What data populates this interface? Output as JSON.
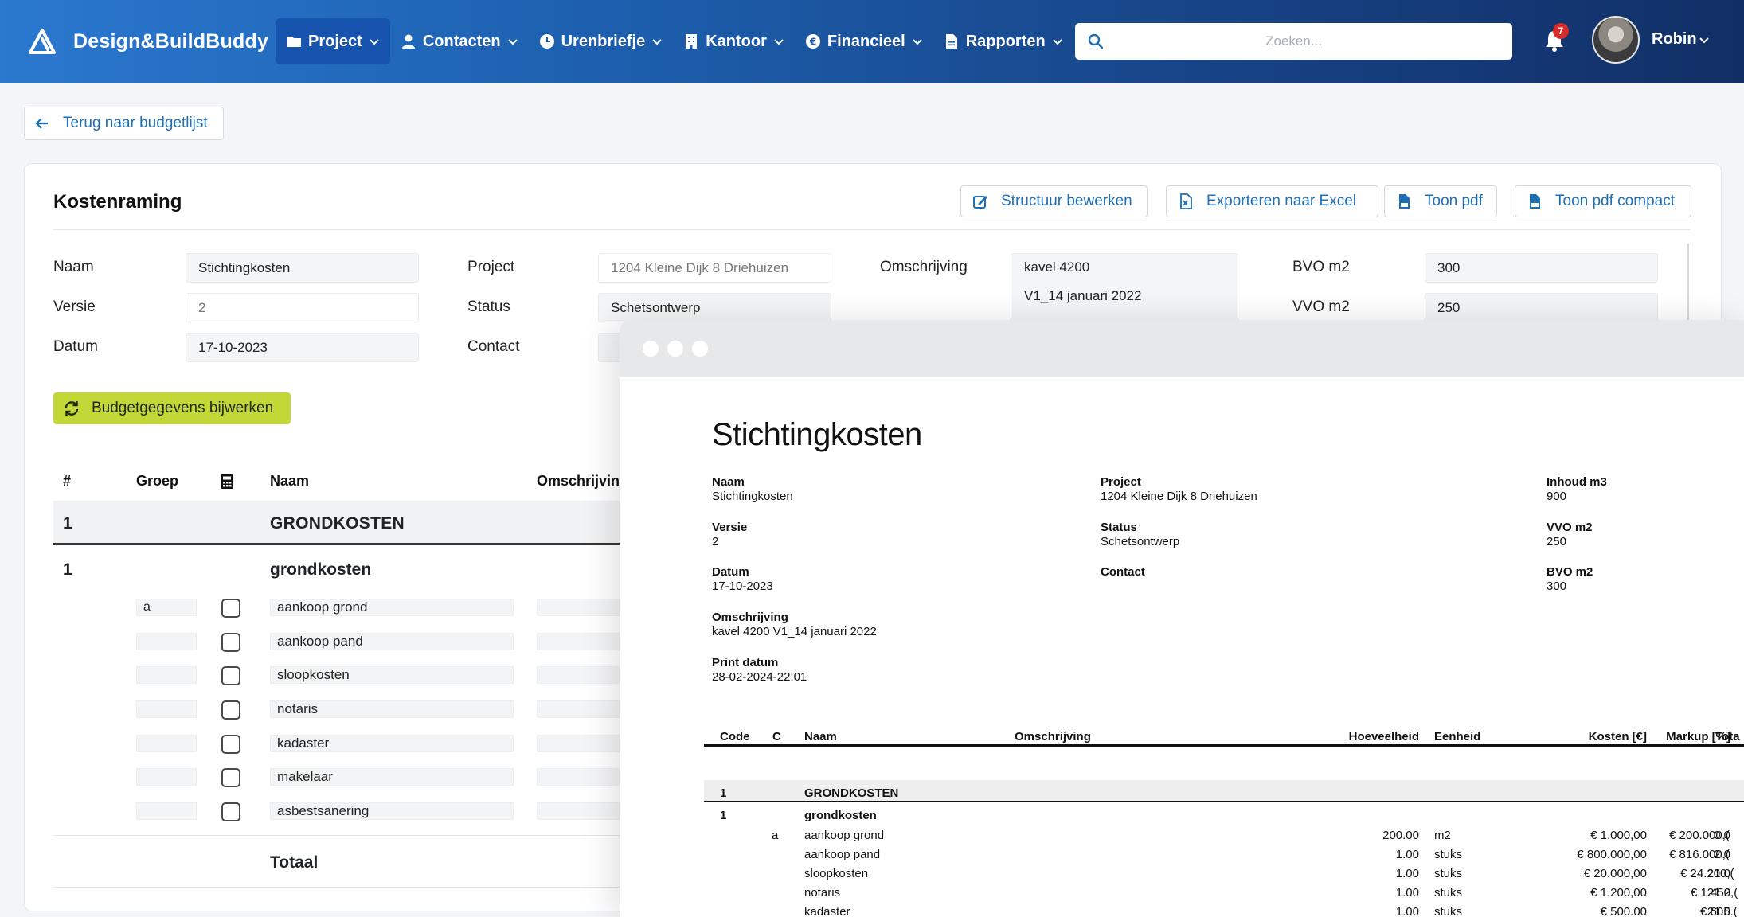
{
  "app": {
    "brand": "Design&BuildBuddy"
  },
  "nav": {
    "items": [
      {
        "label": "Project",
        "icon": "folder-icon",
        "active": true
      },
      {
        "label": "Contacten",
        "icon": "user-icon",
        "active": false
      },
      {
        "label": "Urenbriefje",
        "icon": "clock-icon",
        "active": false
      },
      {
        "label": "Kantoor",
        "icon": "building-icon",
        "active": false
      },
      {
        "label": "Financieel",
        "icon": "euro-icon",
        "active": false
      },
      {
        "label": "Rapporten",
        "icon": "file-icon",
        "active": false
      }
    ],
    "search_placeholder": "Zoeken...",
    "notification_count": "7",
    "user_name": "Robin"
  },
  "back_button": "Terug naar budgetlijst",
  "card": {
    "title": "Kostenraming",
    "toolbar": {
      "edit_structure": "Structuur bewerken",
      "export_excel": "Exporteren naar Excel",
      "show_pdf": "Toon pdf",
      "show_pdf_compact": "Toon pdf compact"
    },
    "fields": {
      "naam_label": "Naam",
      "naam_value": "Stichtingkosten",
      "versie_label": "Versie",
      "versie_value": "2",
      "datum_label": "Datum",
      "datum_value": "17-10-2023",
      "project_label": "Project",
      "project_value": "1204 Kleine Dijk 8 Driehuizen",
      "status_label": "Status",
      "status_value": "Schetsontwerp",
      "contact_label": "Contact",
      "omschrijving_label": "Omschrijving",
      "omschrijving_line1": "kavel 4200",
      "omschrijving_line2": "V1_14 januari 2022",
      "bvo_label": "BVO m2",
      "bvo_value": "300",
      "vvo_label": "VVO m2",
      "vvo_value": "250"
    },
    "update_button": "Budgetgegevens bijwerken",
    "table": {
      "headers": {
        "num": "#",
        "groep": "Groep",
        "naam": "Naam",
        "omschrijving": "Omschrijvin"
      },
      "group": {
        "num": "1",
        "name": "GRONDKOSTEN"
      },
      "subgroup": {
        "num": "1",
        "name": "grondkosten"
      },
      "items": [
        {
          "code": "a",
          "name": "aankoop grond"
        },
        {
          "code": "",
          "name": "aankoop pand"
        },
        {
          "code": "",
          "name": "sloopkosten"
        },
        {
          "code": "",
          "name": "notaris"
        },
        {
          "code": "",
          "name": "kadaster"
        },
        {
          "code": "",
          "name": "makelaar"
        },
        {
          "code": "",
          "name": "asbestsanering"
        }
      ],
      "total_label": "Totaal"
    }
  },
  "pdf": {
    "title": "Stichtingkosten",
    "meta": {
      "naam_label": "Naam",
      "naam": "Stichtingkosten",
      "versie_label": "Versie",
      "versie": "2",
      "datum_label": "Datum",
      "datum": "17-10-2023",
      "omschrijving_label": "Omschrijving",
      "omschrijving": "kavel 4200 V1_14 januari 2022",
      "print_label": "Print datum",
      "print": "28-02-2024-22:01",
      "project_label": "Project",
      "project": "1204 Kleine Dijk 8 Driehuizen",
      "status_label": "Status",
      "status": "Schetsontwerp",
      "contact_label": "Contact",
      "inhoud_label": "Inhoud m3",
      "inhoud": "900",
      "vvo_label": "VVO m2",
      "vvo": "250",
      "bvo_label": "BVO m2",
      "bvo": "300"
    },
    "table": {
      "headers": {
        "code": "Code",
        "c": "C",
        "naam": "Naam",
        "omschrijving": "Omschrijving",
        "hoeveelheid": "Hoeveelheid",
        "eenheid": "Eenheid",
        "kosten": "Kosten [€]",
        "markup": "Markup [%]",
        "totaal": "Tota"
      },
      "group": {
        "code": "1",
        "name": "GRONDKOSTEN"
      },
      "subgroup": {
        "code": "1",
        "name": "grondkosten"
      },
      "rows": [
        {
          "c": "a",
          "naam": "aankoop grond",
          "hoeveelheid": "200.00",
          "eenheid": "m2",
          "kosten": "€ 1.000,00",
          "markup": "0.0",
          "totaal": "€ 200.000,("
        },
        {
          "c": "",
          "naam": "aankoop pand",
          "hoeveelheid": "1.00",
          "eenheid": "stuks",
          "kosten": "€ 800.000,00",
          "markup": "2.0",
          "totaal": "€ 816.000,("
        },
        {
          "c": "",
          "naam": "sloopkosten",
          "hoeveelheid": "1.00",
          "eenheid": "stuks",
          "kosten": "€ 20.000,00",
          "markup": "21.0",
          "totaal": "€ 24.200,("
        },
        {
          "c": "",
          "naam": "notaris",
          "hoeveelheid": "1.00",
          "eenheid": "stuks",
          "kosten": "€ 1.200,00",
          "markup": "21.0",
          "totaal": "€ 1.452,("
        },
        {
          "c": "",
          "naam": "kadaster",
          "hoeveelheid": "1.00",
          "eenheid": "stuks",
          "kosten": "€ 500.00",
          "markup": "21.0",
          "totaal": "€ 605.("
        }
      ]
    }
  }
}
